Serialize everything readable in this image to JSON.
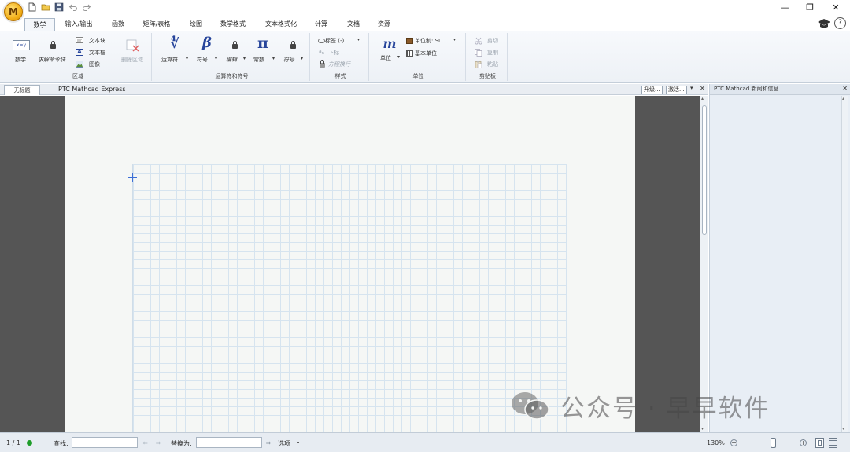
{
  "app": {
    "logo_letter": "M",
    "accent_color": "#f3b01a"
  },
  "window_controls": {
    "minimize": "—",
    "restore": "❐",
    "close": "✕"
  },
  "tabs": [
    {
      "label": "数学",
      "active": true
    },
    {
      "label": "输入/输出",
      "active": false
    },
    {
      "label": "函数",
      "active": false
    },
    {
      "label": "矩阵/表格",
      "active": false
    },
    {
      "label": "绘图",
      "active": false
    },
    {
      "label": "数学格式",
      "active": false
    },
    {
      "label": "文本格式化",
      "active": false
    },
    {
      "label": "计算",
      "active": false
    },
    {
      "label": "文档",
      "active": false
    },
    {
      "label": "资源",
      "active": false
    }
  ],
  "ribbon": {
    "region_group": {
      "label": "区域",
      "math_label": "数学",
      "solve_block_label": "求解命令块",
      "text_block_label": "文本块",
      "text_box_label": "文本框",
      "image_label": "图像",
      "delete_region_label": "删除区域",
      "math_icon_text": "x=y"
    },
    "operators_group": {
      "label": "运算符和符号",
      "operators_label": "运算符",
      "symbols_label": "符号",
      "markup_label": "编辑",
      "constants_label": "常数",
      "symbol_label": "符号",
      "operators_icon": "∜",
      "symbols_icon": "β",
      "constants_icon": "π"
    },
    "style_group": {
      "label": "样式",
      "labels_label": "标签 (-)",
      "subscript_label": "下标",
      "matrix_wrap_label": "方程换行"
    },
    "units_group": {
      "label": "单位",
      "units_label": "单位",
      "unit_system_label": "单位制: SI",
      "base_units_label": "基本单位",
      "units_icon": "m"
    },
    "clipboard_group": {
      "label": "剪贴板",
      "cut_label": "剪切",
      "copy_label": "复制",
      "paste_label": "粘贴"
    }
  },
  "document": {
    "tab_title": "无标题",
    "product_name": "PTC Mathcad Express",
    "upgrade_label": "升级...",
    "activate_label": "激活...",
    "pin_icon": "▾",
    "close_icon": "✕"
  },
  "side_panel": {
    "title": "PTC Mathcad 新闻和信息"
  },
  "watermark": {
    "text": "公众号 · 早早软件"
  },
  "status_bar": {
    "page_indicator": "1 / 1",
    "find_label": "查找:",
    "replace_label": "替换为:",
    "options_label": "选项",
    "zoom_level": "130%",
    "status_color": "#1f9d2a"
  }
}
